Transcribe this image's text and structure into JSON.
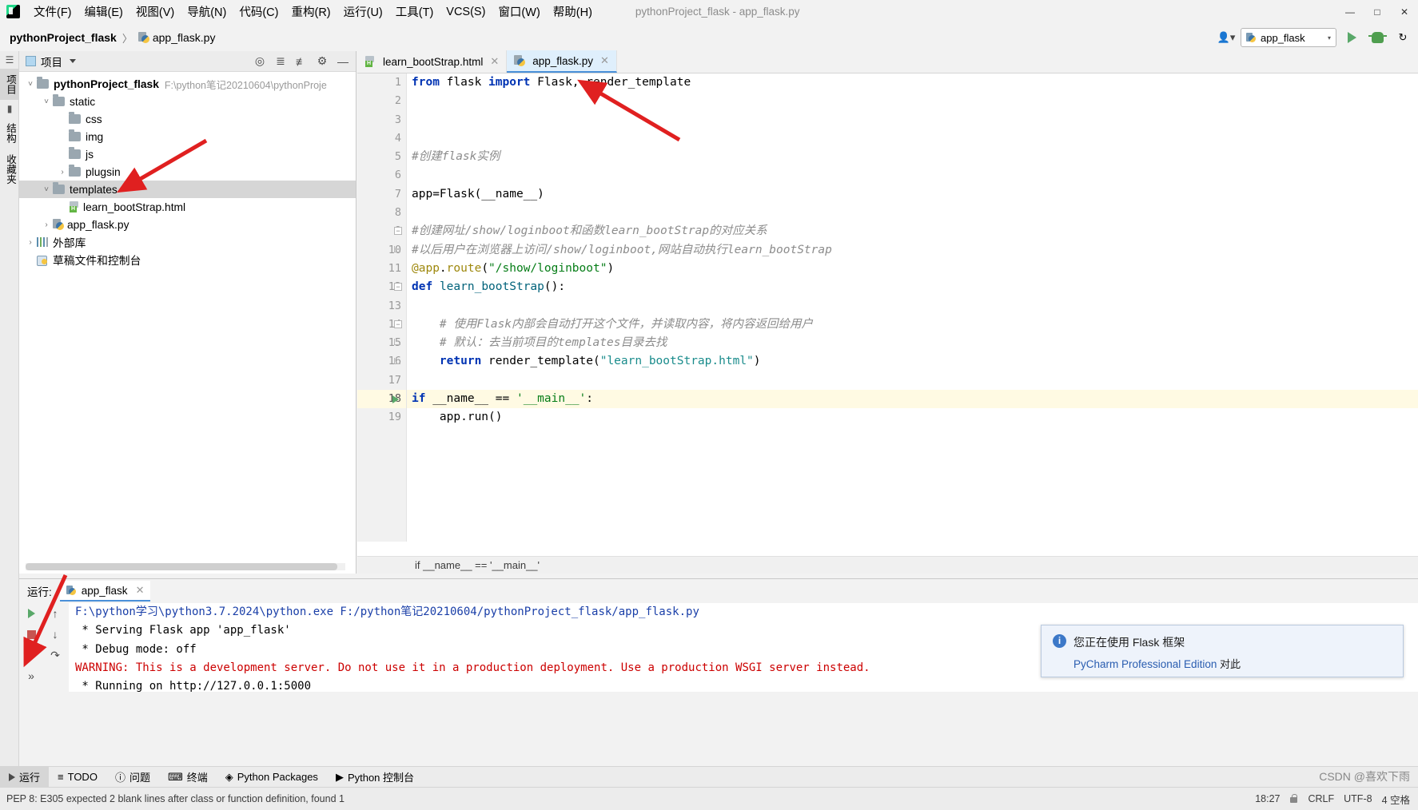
{
  "window": {
    "title": "pythonProject_flask - app_flask.py",
    "controls": [
      "—",
      "□",
      "✕"
    ]
  },
  "menubar": {
    "logo": "pycharm-logo",
    "items": [
      {
        "label": "文件(F)"
      },
      {
        "label": "编辑(E)"
      },
      {
        "label": "视图(V)"
      },
      {
        "label": "导航(N)"
      },
      {
        "label": "代码(C)"
      },
      {
        "label": "重构(R)"
      },
      {
        "label": "运行(U)"
      },
      {
        "label": "工具(T)"
      },
      {
        "label": "VCS(S)"
      },
      {
        "label": "窗口(W)"
      },
      {
        "label": "帮助(H)"
      }
    ]
  },
  "navbar": {
    "breadcrumb_root": "pythonProject_flask",
    "separator": "〉",
    "breadcrumb_file": "app_flask.py",
    "run_config": "app_flask",
    "run_config_caret": "▾"
  },
  "left_strip": {
    "tabs": [
      {
        "label": "项目",
        "selected": true
      },
      {
        "label": "结构",
        "selected": false
      },
      {
        "label": "收藏夹",
        "selected": false
      }
    ]
  },
  "project_panel": {
    "title": "项目",
    "header_icons": [
      "locate-icon",
      "expand-all-icon",
      "collapse-all-icon",
      "settings-gear-icon",
      "hide-icon"
    ],
    "tree": [
      {
        "depth": 0,
        "twisty": "˅",
        "icon": "folder-icon",
        "label": "pythonProject_flask",
        "bold": true,
        "path": "F:\\python笔记20210604\\pythonProje",
        "selected": false
      },
      {
        "depth": 1,
        "twisty": "˅",
        "icon": "folder-icon",
        "label": "static",
        "bold": false,
        "path": "",
        "selected": false
      },
      {
        "depth": 2,
        "twisty": "",
        "icon": "folder-icon",
        "label": "css",
        "bold": false,
        "path": "",
        "selected": false
      },
      {
        "depth": 2,
        "twisty": "",
        "icon": "folder-icon",
        "label": "img",
        "bold": false,
        "path": "",
        "selected": false
      },
      {
        "depth": 2,
        "twisty": "",
        "icon": "folder-icon",
        "label": "js",
        "bold": false,
        "path": "",
        "selected": false
      },
      {
        "depth": 2,
        "twisty": "›",
        "icon": "folder-icon",
        "label": "plugsin",
        "bold": false,
        "path": "",
        "selected": false
      },
      {
        "depth": 1,
        "twisty": "˅",
        "icon": "folder-icon",
        "label": "templates",
        "bold": false,
        "path": "",
        "selected": true
      },
      {
        "depth": 2,
        "twisty": "",
        "icon": "html-file-icon",
        "label": "learn_bootStrap.html",
        "bold": false,
        "path": "",
        "selected": false
      },
      {
        "depth": 1,
        "twisty": "›",
        "icon": "python-file-icon",
        "label": "app_flask.py",
        "bold": false,
        "path": "",
        "selected": false
      },
      {
        "depth": 0,
        "twisty": "›",
        "icon": "library-icon",
        "label": "外部库",
        "bold": false,
        "path": "",
        "selected": false
      },
      {
        "depth": 0,
        "twisty": "",
        "icon": "scratch-icon",
        "label": "草稿文件和控制台",
        "bold": false,
        "path": "",
        "selected": false
      }
    ]
  },
  "editor": {
    "tabs": [
      {
        "label": "learn_bootStrap.html",
        "icon": "html-file-icon",
        "active": false,
        "close": "✕"
      },
      {
        "label": "app_flask.py",
        "icon": "python-file-icon",
        "active": true,
        "close": "✕"
      }
    ],
    "lines": [
      {
        "n": "1",
        "fold": "",
        "run": false,
        "hl": false,
        "tokens": [
          {
            "t": "from",
            "c": "kw"
          },
          {
            "t": " flask ",
            "c": "plain"
          },
          {
            "t": "import",
            "c": "kw"
          },
          {
            "t": " Flask, render_template",
            "c": "plain"
          }
        ]
      },
      {
        "n": "2",
        "fold": "",
        "run": false,
        "hl": false,
        "tokens": []
      },
      {
        "n": "3",
        "fold": "",
        "run": false,
        "hl": false,
        "tokens": []
      },
      {
        "n": "4",
        "fold": "",
        "run": false,
        "hl": false,
        "tokens": []
      },
      {
        "n": "5",
        "fold": "",
        "run": false,
        "hl": false,
        "tokens": [
          {
            "t": "#创建flask实例",
            "c": "cmt"
          }
        ]
      },
      {
        "n": "6",
        "fold": "",
        "run": false,
        "hl": false,
        "tokens": []
      },
      {
        "n": "7",
        "fold": "",
        "run": false,
        "hl": false,
        "tokens": [
          {
            "t": "app=Flask(__name__)",
            "c": "plain"
          }
        ]
      },
      {
        "n": "8",
        "fold": "",
        "run": false,
        "hl": false,
        "tokens": []
      },
      {
        "n": "9",
        "fold": "start",
        "run": false,
        "hl": false,
        "tokens": [
          {
            "t": "#创建网址/show/loginboot和函数learn_bootStrap的对应关系",
            "c": "cmt"
          }
        ]
      },
      {
        "n": "10",
        "fold": "end",
        "run": false,
        "hl": false,
        "tokens": [
          {
            "t": "#以后用户在浏览器上访问/show/loginboot,网站自动执行learn_bootStrap",
            "c": "cmt"
          }
        ]
      },
      {
        "n": "11",
        "fold": "",
        "run": false,
        "hl": false,
        "tokens": [
          {
            "t": "@app",
            "c": "deco"
          },
          {
            "t": ".",
            "c": "plain"
          },
          {
            "t": "route",
            "c": "deco"
          },
          {
            "t": "(",
            "c": "plain"
          },
          {
            "t": "\"/show/loginboot\"",
            "c": "str"
          },
          {
            "t": ")",
            "c": "plain"
          }
        ]
      },
      {
        "n": "12",
        "fold": "start",
        "run": false,
        "hl": false,
        "tokens": [
          {
            "t": "def",
            "c": "kw"
          },
          {
            "t": " ",
            "c": "plain"
          },
          {
            "t": "learn_bootStrap",
            "c": "fn"
          },
          {
            "t": "():",
            "c": "plain"
          }
        ]
      },
      {
        "n": "13",
        "fold": "",
        "run": false,
        "hl": false,
        "tokens": []
      },
      {
        "n": "14",
        "fold": "start",
        "run": false,
        "hl": false,
        "tokens": [
          {
            "t": "    # 使用Flask内部会自动打开这个文件，并读取内容，将内容返回给用户",
            "c": "cmt"
          }
        ]
      },
      {
        "n": "15",
        "fold": "mid",
        "run": false,
        "hl": false,
        "tokens": [
          {
            "t": "    # 默认：去当前项目的templates目录去找",
            "c": "cmt"
          }
        ]
      },
      {
        "n": "16",
        "fold": "end",
        "run": false,
        "hl": false,
        "tokens": [
          {
            "t": "    ",
            "c": "plain"
          },
          {
            "t": "return",
            "c": "kw"
          },
          {
            "t": " render_template(",
            "c": "plain"
          },
          {
            "t": "\"learn_bootStrap.html\"",
            "c": "str2"
          },
          {
            "t": ")",
            "c": "plain"
          }
        ]
      },
      {
        "n": "17",
        "fold": "",
        "run": false,
        "hl": false,
        "tokens": []
      },
      {
        "n": "18",
        "fold": "",
        "run": true,
        "hl": true,
        "tokens": [
          {
            "t": "if",
            "c": "kw"
          },
          {
            "t": " __name__ ",
            "c": "plain"
          },
          {
            "t": "==",
            "c": "plain"
          },
          {
            "t": " ",
            "c": "plain"
          },
          {
            "t": "'__main__'",
            "c": "str"
          },
          {
            "t": ":",
            "c": "plain"
          }
        ]
      },
      {
        "n": "19",
        "fold": "",
        "run": false,
        "hl": false,
        "tokens": [
          {
            "t": "    app.run()",
            "c": "plain"
          }
        ]
      }
    ],
    "bottom_breadcrumb": "if __name__ == '__main__'"
  },
  "run_window": {
    "label": "运行:",
    "tab_label": "app_flask",
    "tab_close": "✕",
    "side_buttons": [
      "run-icon",
      "up-arrow-icon",
      "stop-icon",
      "down-arrow-icon",
      "more-icon",
      "wrap-icon",
      "expand-icon"
    ],
    "console": [
      {
        "text": "F:\\python学习\\python3.7.2024\\python.exe F:/python笔记20210604/pythonProject_flask/app_flask.py",
        "color": "blue"
      },
      {
        "text": " * Serving Flask app 'app_flask'",
        "color": "black"
      },
      {
        "text": " * Debug mode: off",
        "color": "black"
      },
      {
        "text": "WARNING: This is a development server. Do not use it in a production deployment. Use a production WSGI server instead.",
        "color": "red"
      },
      {
        "text": " * Running on http://127.0.0.1:5000",
        "color": "black"
      }
    ]
  },
  "bottom_toolbar": {
    "items": [
      {
        "label": "运行",
        "icon": "run-triangle-icon",
        "selected": true
      },
      {
        "label": "TODO",
        "icon": "todo-icon",
        "selected": false
      },
      {
        "label": "问题",
        "icon": "problems-icon",
        "selected": false
      },
      {
        "label": "终端",
        "icon": "terminal-icon",
        "selected": false
      },
      {
        "label": "Python Packages",
        "icon": "packages-icon",
        "selected": false
      },
      {
        "label": "Python 控制台",
        "icon": "python-console-icon",
        "selected": false
      }
    ]
  },
  "statusbar": {
    "left_text": "PEP 8: E305 expected 2 blank lines after class or function definition, found 1",
    "position": "18:27",
    "line_sep": "CRLF",
    "encoding": "UTF-8",
    "indent": "4 空格",
    "lock": "lock-icon"
  },
  "notification": {
    "icon": "info-icon",
    "title": "您正在使用 Flask 框架",
    "link": "PyCharm Professional Edition",
    "tail": " 对此"
  },
  "watermark": "CSDN @喜欢下雨"
}
